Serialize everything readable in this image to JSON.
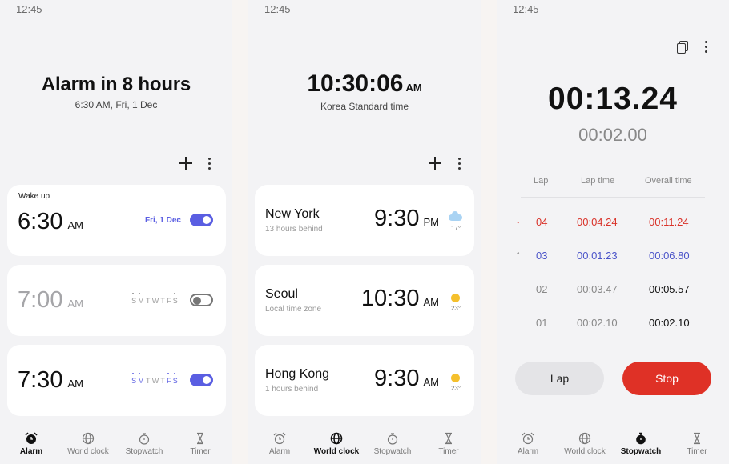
{
  "screens": {
    "alarm": {
      "status_time": "12:45",
      "headline": "Alarm in 8 hours",
      "subline": "6:30 AM, Fri, 1 Dec",
      "alarms": [
        {
          "label": "Wake up",
          "time": "6:30",
          "ampm": "AM",
          "date": "Fri, 1 Dec",
          "enabled": true
        },
        {
          "label": "",
          "time": "7:00",
          "ampm": "AM",
          "days": "SMTWTFS",
          "enabled": false
        },
        {
          "label": "",
          "time": "7:30",
          "ampm": "AM",
          "days": "SMTWTFS",
          "enabled": true
        }
      ]
    },
    "world_clock": {
      "status_time": "12:45",
      "clock": "10:30:06",
      "clock_ampm": "AM",
      "zone": "Korea Standard time",
      "cities": [
        {
          "name": "New York",
          "sub": "13 hours behind",
          "time": "9:30",
          "ampm": "PM",
          "weather": "cloud",
          "temp": "17°"
        },
        {
          "name": "Seoul",
          "sub": "Local time zone",
          "time": "10:30",
          "ampm": "AM",
          "weather": "sun",
          "temp": "23°"
        },
        {
          "name": "Hong Kong",
          "sub": "1 hours behind",
          "time": "9:30",
          "ampm": "AM",
          "weather": "sun",
          "temp": "23°"
        }
      ]
    },
    "stopwatch": {
      "status_time": "12:45",
      "main_time": "00:13.24",
      "lap_time": "00:02.00",
      "headers": {
        "lap": "Lap",
        "lap_time": "Lap time",
        "overall": "Overall time"
      },
      "laps": [
        {
          "arrow": "↓",
          "lap": "04",
          "lap_time": "00:04.24",
          "overall": "00:11.24",
          "tone": "red"
        },
        {
          "arrow": "↑",
          "lap": "03",
          "lap_time": "00:01.23",
          "overall": "00:06.80",
          "tone": "blue"
        },
        {
          "arrow": "",
          "lap": "02",
          "lap_time": "00:03.47",
          "overall": "00:05.57",
          "tone": "plain"
        },
        {
          "arrow": "",
          "lap": "01",
          "lap_time": "00:02.10",
          "overall": "00:02.10",
          "tone": "plain"
        }
      ],
      "lap_button": "Lap",
      "stop_button": "Stop"
    }
  },
  "nav": {
    "alarm": "Alarm",
    "world_clock": "World clock",
    "stopwatch": "Stopwatch",
    "timer": "Timer"
  },
  "colors": {
    "accent": "#5a5ee2",
    "stop": "#df3126",
    "best_lap": "#4b54c9",
    "worst_lap": "#d93229"
  }
}
